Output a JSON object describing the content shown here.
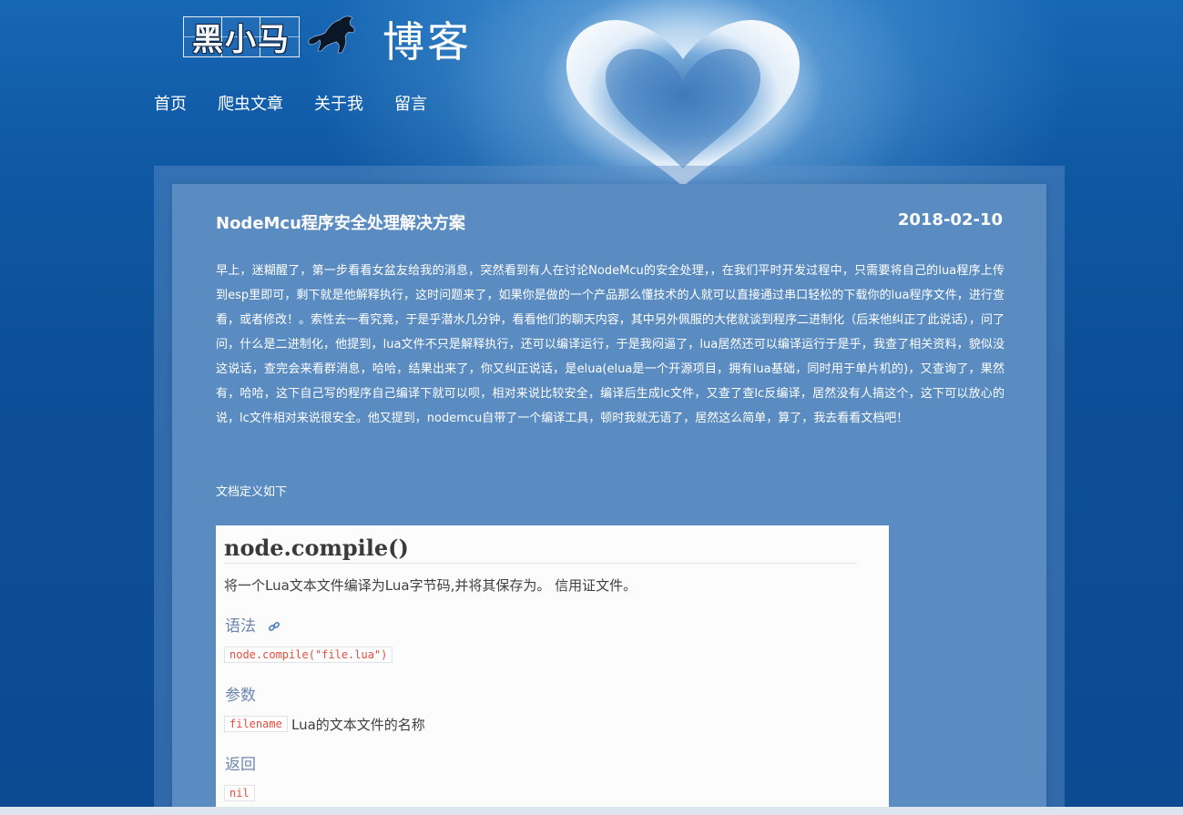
{
  "header": {
    "logo_text": "黑小马",
    "blog_title": "博客"
  },
  "nav": {
    "items": [
      {
        "label": "首页"
      },
      {
        "label": "爬虫文章"
      },
      {
        "label": "关于我"
      },
      {
        "label": "留言"
      }
    ]
  },
  "post": {
    "title": "NodeMcu程序安全处理解决方案",
    "date": "2018-02-10",
    "body": "早上，迷糊醒了，第一步看看女盆友给我的消息，突然看到有人在讨论NodeMcu的安全处理，，在我们平时开发过程中，只需要将自己的lua程序上传到esp里即可，剩下就是他解释执行，这时问题来了，如果你是做的一个产品那么懂技术的人就可以直接通过串口轻松的下载你的lua程序文件，进行查看，或者修改！。索性去一看究竟，于是乎潜水几分钟，看看他们的聊天内容，其中另外佩服的大佬就谈到程序二进制化（后来他纠正了此说话），问了问，什么是二进制化，他提到，lua文件不只是解释执行，还可以编译运行，于是我闷逼了，lua居然还可以编译运行于是乎，我查了相关资料，貌似没这说话，查完会来看群消息，哈哈，结果出来了，你又纠正说话，是elua(elua是一个开源项目，拥有lua基础，同时用于单片机的)，又查询了，果然有，哈哈，这下自己写的程序自己编译下就可以呗，相对来说比较安全，编译后生成lc文件，又查了查lc反编译，居然没有人搞这个，这下可以放心的说，lc文件相对来说很安全。他又提到，nodemcu自带了一个编译工具，顿时我就无语了，居然这么简单，算了，我去看看文档吧！",
    "doc_intro": "文档定义如下"
  },
  "doc": {
    "heading": "node.compile()",
    "description": "将一个Lua文本文件编译为Lua字节码,并将其保存为。 信用证文件。",
    "syntax_label": "语法",
    "syntax_code": "node.compile(\"file.lua\")",
    "params_label": "参数",
    "param_name": "filename",
    "param_desc": "Lua的文本文件的名称",
    "returns_label": "返回",
    "returns_value": "nil"
  }
}
